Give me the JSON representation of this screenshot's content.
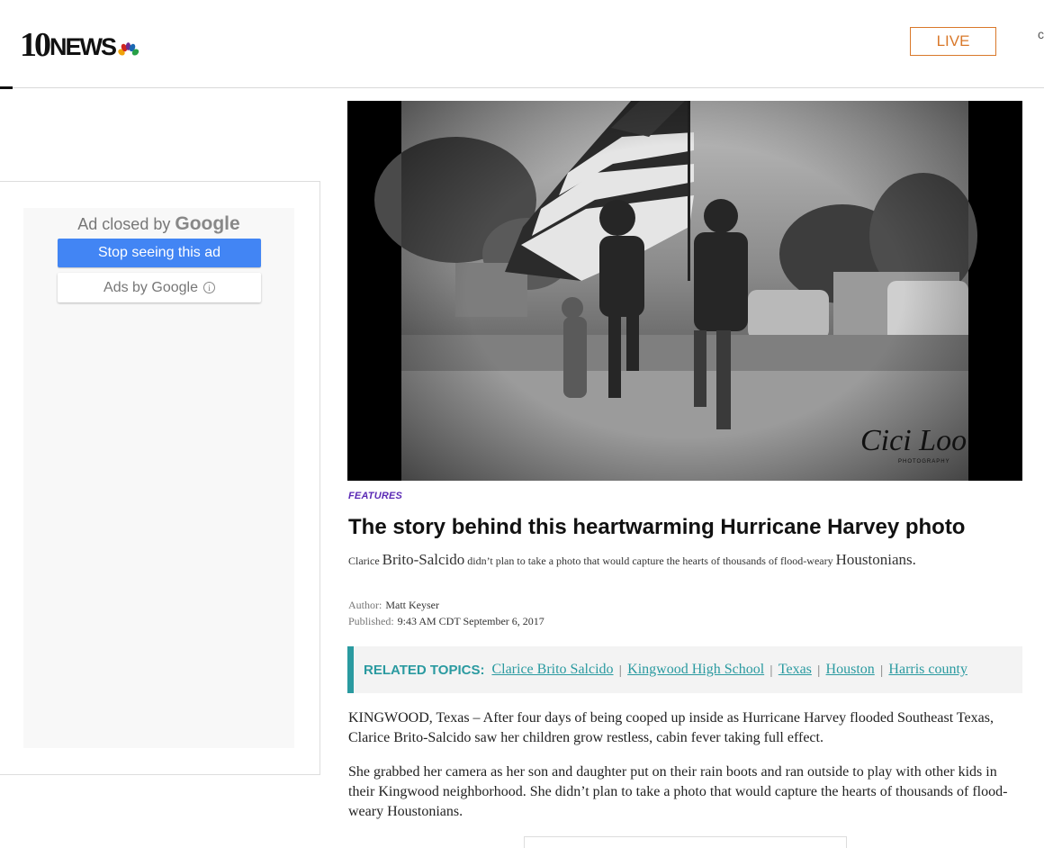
{
  "header": {
    "logo_number": "10",
    "logo_word": "NEWS",
    "live_label": "LIVE",
    "accent_color": "#d9782a"
  },
  "ad": {
    "closed_by": "Ad closed by",
    "google": "Google",
    "stop_label": "Stop seeing this ad",
    "ads_by_label": "Ads by Google",
    "info_glyph": "i"
  },
  "hero": {
    "watermark_script": "Cici Loo",
    "watermark_small": "PHOTOGRAPHY"
  },
  "article": {
    "category": "FEATURES",
    "title": "The story behind this heartwarming Hurricane Harvey photo",
    "subtitle_parts": [
      "Clarice",
      "Brito-Salcido",
      "didn’t plan to take a photo that would capture the hearts of thousands of flood-weary",
      "Houstonians."
    ],
    "author_label": "Author:",
    "author": "Matt Keyser",
    "published_label": "Published:",
    "published": "9:43 AM CDT September 6, 2017",
    "related_label": "RELATED TOPICS:",
    "topics": [
      "Clarice Brito Salcido",
      "Kingwood High School",
      "Texas",
      "Houston",
      "Harris county"
    ],
    "topic_separator": "|",
    "paragraphs": [
      "KINGWOOD, Texas – After four days of being cooped up inside as Hurricane Harvey flooded Southeast Texas, Clarice Brito-Salcido saw her children grow restless, cabin fever taking full effect.",
      "She grabbed her camera as her son and daughter put on their rain boots and ran outside to play with other kids in their Kingwood neighborhood. She didn’t plan to take a photo that would capture the hearts of thousands of flood-weary Houstonians."
    ],
    "topic_color": "#2a9aa0",
    "category_color": "#5b2ab5"
  }
}
